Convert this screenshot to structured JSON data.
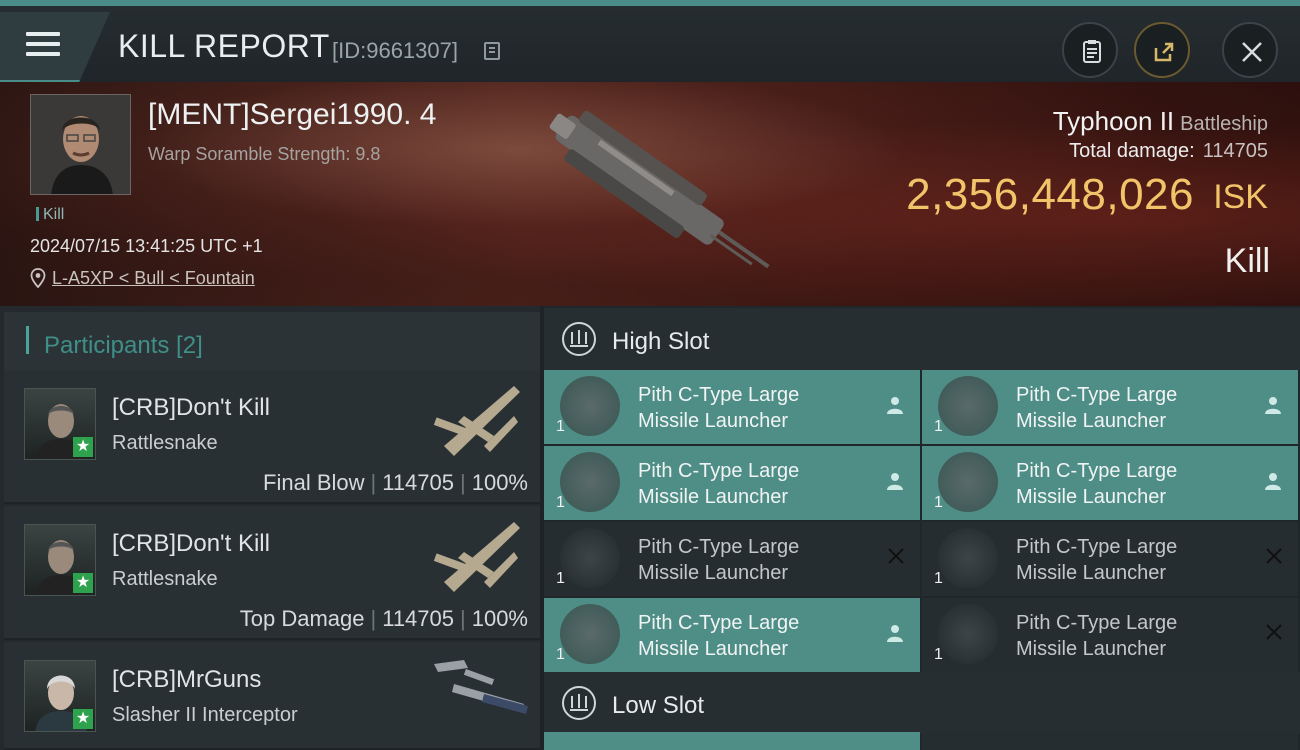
{
  "header": {
    "title": "KILL REPORT",
    "report_id": "[ID:9661307]"
  },
  "victim": {
    "name": "[MENT]Sergei1990. 4",
    "warp_scramble": "Warp Soramble Strength: 9.8",
    "tag": "Kill",
    "datetime": "2024/07/15 13:41:25 UTC +1",
    "location": "L-A5XP < Bull < Fountain"
  },
  "ship": {
    "name": "Typhoon II",
    "class": "Battleship",
    "total_damage_label": "Total damage:",
    "total_damage": "114705",
    "isk_value": "2,356,448,026",
    "isk_label": "ISK",
    "result": "Kill"
  },
  "participants": {
    "title": "Participants [2]",
    "items": [
      {
        "name": "[CRB]Don't Kill",
        "ship": "Rattlesnake",
        "role": "Final Blow",
        "damage": "114705",
        "percent": "100%"
      },
      {
        "name": "[CRB]Don't Kill",
        "ship": "Rattlesnake",
        "role": "Top Damage",
        "damage": "114705",
        "percent": "100%"
      },
      {
        "name": "[CRB]MrGuns",
        "ship": "Slasher II Interceptor",
        "role": "",
        "damage": "",
        "percent": ""
      }
    ]
  },
  "high_slot": {
    "title": "High Slot",
    "modules": [
      {
        "line1": "Pith C-Type Large",
        "line2": "Missile Launcher",
        "qty": "1",
        "state": "active"
      },
      {
        "line1": "Pith C-Type Large",
        "line2": "Missile Launcher",
        "qty": "1",
        "state": "active"
      },
      {
        "line1": "Pith C-Type Large",
        "line2": "Missile Launcher",
        "qty": "1",
        "state": "active"
      },
      {
        "line1": "Pith C-Type Large",
        "line2": "Missile Launcher",
        "qty": "1",
        "state": "active"
      },
      {
        "line1": "Pith C-Type Large",
        "line2": "Missile Launcher",
        "qty": "1",
        "state": "destroyed"
      },
      {
        "line1": "Pith C-Type Large",
        "line2": "Missile Launcher",
        "qty": "1",
        "state": "destroyed"
      },
      {
        "line1": "Pith C-Type Large",
        "line2": "Missile Launcher",
        "qty": "1",
        "state": "active"
      },
      {
        "line1": "Pith C-Type Large",
        "line2": "Missile Launcher",
        "qty": "1",
        "state": "destroyed"
      }
    ]
  },
  "low_slot": {
    "title": "Low Slot"
  },
  "colors": {
    "accent": "#4a8d88",
    "isk": "#f2c46a",
    "active_module": "#4f8e87"
  }
}
